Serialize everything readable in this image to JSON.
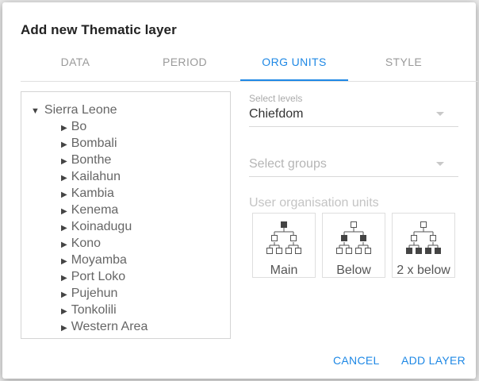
{
  "dialog": {
    "title": "Add new Thematic layer"
  },
  "tabs": [
    {
      "label": "DATA"
    },
    {
      "label": "PERIOD"
    },
    {
      "label": "ORG UNITS"
    },
    {
      "label": "STYLE"
    }
  ],
  "active_tab": "ORG UNITS",
  "tree": {
    "root": "Sierra Leone",
    "children": [
      "Bo",
      "Bombali",
      "Bonthe",
      "Kailahun",
      "Kambia",
      "Kenema",
      "Koinadugu",
      "Kono",
      "Moyamba",
      "Port Loko",
      "Pujehun",
      "Tonkolili",
      "Western Area"
    ]
  },
  "levels": {
    "label": "Select levels",
    "value": "Chiefdom"
  },
  "groups": {
    "placeholder": "Select groups"
  },
  "user_org_units": {
    "label": "User organisation units",
    "buttons": [
      {
        "label": "Main",
        "icon": "hierarchy-main-icon"
      },
      {
        "label": "Below",
        "icon": "hierarchy-below-icon"
      },
      {
        "label": "2 x below",
        "icon": "hierarchy-2x-below-icon"
      }
    ]
  },
  "actions": {
    "cancel": "CANCEL",
    "add": "ADD LAYER"
  },
  "colors": {
    "accent": "#1e88e5",
    "text": "#333333",
    "muted": "#9a9a9a"
  }
}
